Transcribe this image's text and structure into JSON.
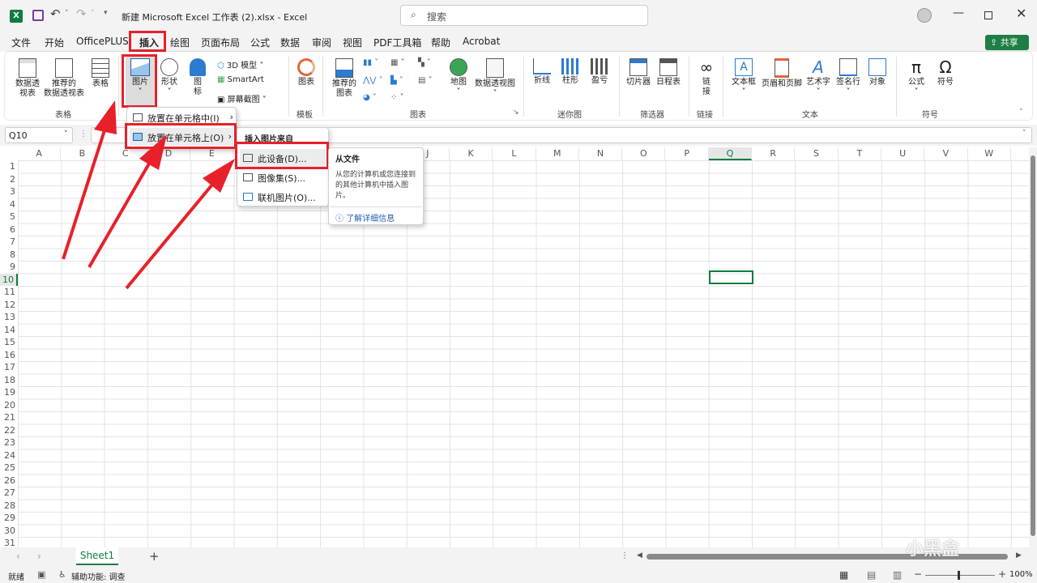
{
  "window": {
    "title": "新建 Microsoft Excel 工作表 (2).xlsx  -  Excel",
    "search_placeholder": "搜索",
    "share_label": "共享"
  },
  "tabs": [
    "文件",
    "开始",
    "OfficePLUS",
    "插入",
    "绘图",
    "页面布局",
    "公式",
    "数据",
    "审阅",
    "视图",
    "PDF工具箱",
    "帮助",
    "Acrobat"
  ],
  "ribbon": {
    "tables": {
      "pivot": "数据透\n视表",
      "pivot2": "视表 ˅",
      "recommended_pivot_1": "推荐的",
      "recommended_pivot_2": "数据透视表",
      "table": "表格",
      "group": "表格"
    },
    "illustrations": {
      "pictures": "图片",
      "shapes": "形状",
      "icons_1": "图",
      "icons_2": "标",
      "model3d": "3D 模型",
      "smartart": "SmartArt",
      "screenshot": "屏幕截图"
    },
    "templates": {
      "chart_template": "图表",
      "group": "模板"
    },
    "charts": {
      "recommended_1": "推荐的",
      "recommended_2": "图表",
      "map": "地图",
      "pivot_chart": "数据透视图",
      "group": "图表"
    },
    "sparklines": {
      "line": "折线",
      "column": "柱形",
      "winloss": "盈亏",
      "group": "迷你图"
    },
    "filters": {
      "slicer": "切片器",
      "timeline": "日程表",
      "group": "筛选器"
    },
    "links": {
      "link_1": "链",
      "link_2": "接",
      "group": "链接"
    },
    "text": {
      "textbox": "文本框",
      "header_footer": "页眉和页脚",
      "wordart": "艺术字",
      "signature": "签名行",
      "object": "对象",
      "group": "文本"
    },
    "symbols": {
      "equation": "公式",
      "symbol": "符号",
      "group": "符号"
    }
  },
  "namebox": "Q10",
  "columns": [
    "A",
    "B",
    "C",
    "D",
    "E",
    "F",
    "G",
    "H",
    "I",
    "J",
    "K",
    "L",
    "M",
    "N",
    "O",
    "P",
    "Q",
    "R",
    "S",
    "T",
    "U",
    "V",
    "W"
  ],
  "rows": [
    "1",
    "2",
    "3",
    "4",
    "5",
    "6",
    "7",
    "8",
    "9",
    "10",
    "11",
    "12",
    "13",
    "14",
    "15",
    "16",
    "17",
    "18",
    "19",
    "20",
    "21",
    "22",
    "23",
    "24",
    "25",
    "26",
    "27",
    "28",
    "29",
    "30",
    "31"
  ],
  "menu1": {
    "item1": "放置在单元格中(I)",
    "item2": "放置在单元格上(O)"
  },
  "menu2": {
    "header": "插入图片来自",
    "item1": "此设备(D)...",
    "item2": "图像集(S)...",
    "item3": "联机图片(O)..."
  },
  "tooltip": {
    "title": "从文件",
    "body": "从您的计算机或您连接到的其他计算机中插入图片。",
    "link": "了解详细信息"
  },
  "sheet": {
    "name": "Sheet1"
  },
  "status": {
    "ready": "就绪",
    "accessibility": "辅助功能: 调查",
    "zoom": "100%"
  },
  "watermark": "小黑盒",
  "colors": {
    "accent_red": "#e8202a",
    "excel_green": "#107c41",
    "share_green": "#1e7e45"
  }
}
